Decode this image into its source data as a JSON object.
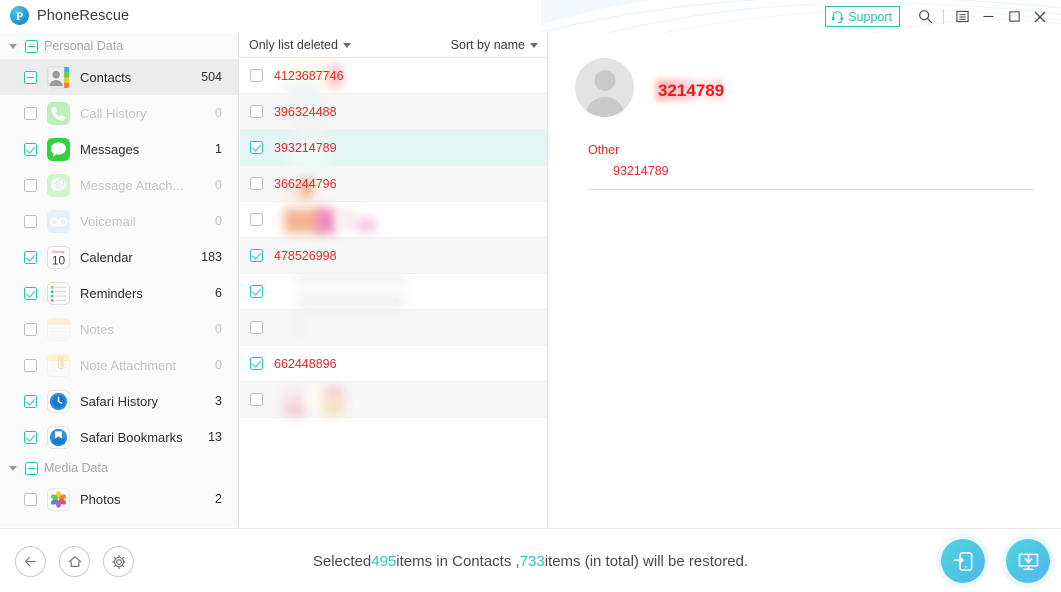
{
  "window": {
    "app_title": "PhoneRescue",
    "logo_letter": "P",
    "support_label": "Support",
    "icons": {
      "search": "search-icon",
      "menu": "menu-icon",
      "minimize": "minimize-icon",
      "maximize": "maximize-icon",
      "close": "close-icon"
    }
  },
  "sidebar": {
    "groups": [
      {
        "label": "Personal Data",
        "check_state": "dash",
        "items": [
          {
            "label": "Contacts",
            "count": "504",
            "check_state": "dash",
            "enabled": true,
            "selected": true,
            "icon": "contacts-icon"
          },
          {
            "label": "Call History",
            "count": "0",
            "check_state": "empty",
            "enabled": false,
            "selected": false,
            "icon": "call-history-icon"
          },
          {
            "label": "Messages",
            "count": "1",
            "check_state": "checked",
            "enabled": true,
            "selected": false,
            "icon": "messages-icon"
          },
          {
            "label": "Message Attach...",
            "count": "0",
            "check_state": "empty",
            "enabled": false,
            "selected": false,
            "icon": "message-attachment-icon"
          },
          {
            "label": "Voicemail",
            "count": "0",
            "check_state": "empty",
            "enabled": false,
            "selected": false,
            "icon": "voicemail-icon"
          },
          {
            "label": "Calendar",
            "count": "183",
            "check_state": "checked",
            "enabled": true,
            "selected": false,
            "icon": "calendar-icon"
          },
          {
            "label": "Reminders",
            "count": "6",
            "check_state": "checked",
            "enabled": true,
            "selected": false,
            "icon": "reminders-icon"
          },
          {
            "label": "Notes",
            "count": "0",
            "check_state": "empty",
            "enabled": false,
            "selected": false,
            "icon": "notes-icon"
          },
          {
            "label": "Note Attachment",
            "count": "0",
            "check_state": "empty",
            "enabled": false,
            "selected": false,
            "icon": "note-attachment-icon"
          },
          {
            "label": "Safari History",
            "count": "3",
            "check_state": "checked",
            "enabled": true,
            "selected": false,
            "icon": "safari-history-icon"
          },
          {
            "label": "Safari Bookmarks",
            "count": "13",
            "check_state": "checked",
            "enabled": true,
            "selected": false,
            "icon": "safari-bookmarks-icon"
          }
        ]
      },
      {
        "label": "Media Data",
        "check_state": "dash",
        "items": [
          {
            "label": "Photos",
            "count": "2",
            "check_state": "empty",
            "enabled": true,
            "selected": false,
            "icon": "photos-icon"
          }
        ]
      }
    ]
  },
  "list_panel": {
    "filter_label": "Only list deleted",
    "sort_label": "Sort by name",
    "rows": [
      {
        "text": "4123687746",
        "check_state": "empty",
        "selected": false,
        "redacted": true
      },
      {
        "text": "396324488",
        "check_state": "empty",
        "selected": false,
        "redacted": true
      },
      {
        "text": "393214789",
        "check_state": "checked",
        "selected": true,
        "redacted": true
      },
      {
        "text": "366244796",
        "check_state": "empty",
        "selected": false,
        "redacted": true
      },
      {
        "text": "",
        "check_state": "empty",
        "selected": false,
        "redacted": true
      },
      {
        "text": "478526998",
        "check_state": "checked",
        "selected": false,
        "redacted": false
      },
      {
        "text": "",
        "check_state": "checked",
        "selected": false,
        "redacted": true
      },
      {
        "text": "",
        "check_state": "empty",
        "selected": false,
        "redacted": true
      },
      {
        "text": "662448896",
        "check_state": "checked",
        "selected": false,
        "redacted": false
      },
      {
        "text": "",
        "check_state": "empty",
        "selected": false,
        "redacted": true
      }
    ]
  },
  "detail": {
    "name": "3214789",
    "field_label": "Other",
    "field_value": "93214789"
  },
  "bottom": {
    "status_prefix": "Selected ",
    "selected_count": "495",
    "status_mid": " items in Contacts , ",
    "total_count": "733",
    "status_suffix": " items (in total) will be restored.",
    "nav": {
      "back": "back-arrow-icon",
      "home": "home-icon",
      "settings": "gear-icon"
    },
    "actions": {
      "restore_to_device": "restore-to-device-icon",
      "restore_to_computer": "restore-to-computer-icon"
    }
  },
  "colors": {
    "accent_teal": "#22c3b0",
    "status_teal": "#2ec6c0",
    "red_text": "#e8262b",
    "name_red": "#ef1b1b"
  }
}
